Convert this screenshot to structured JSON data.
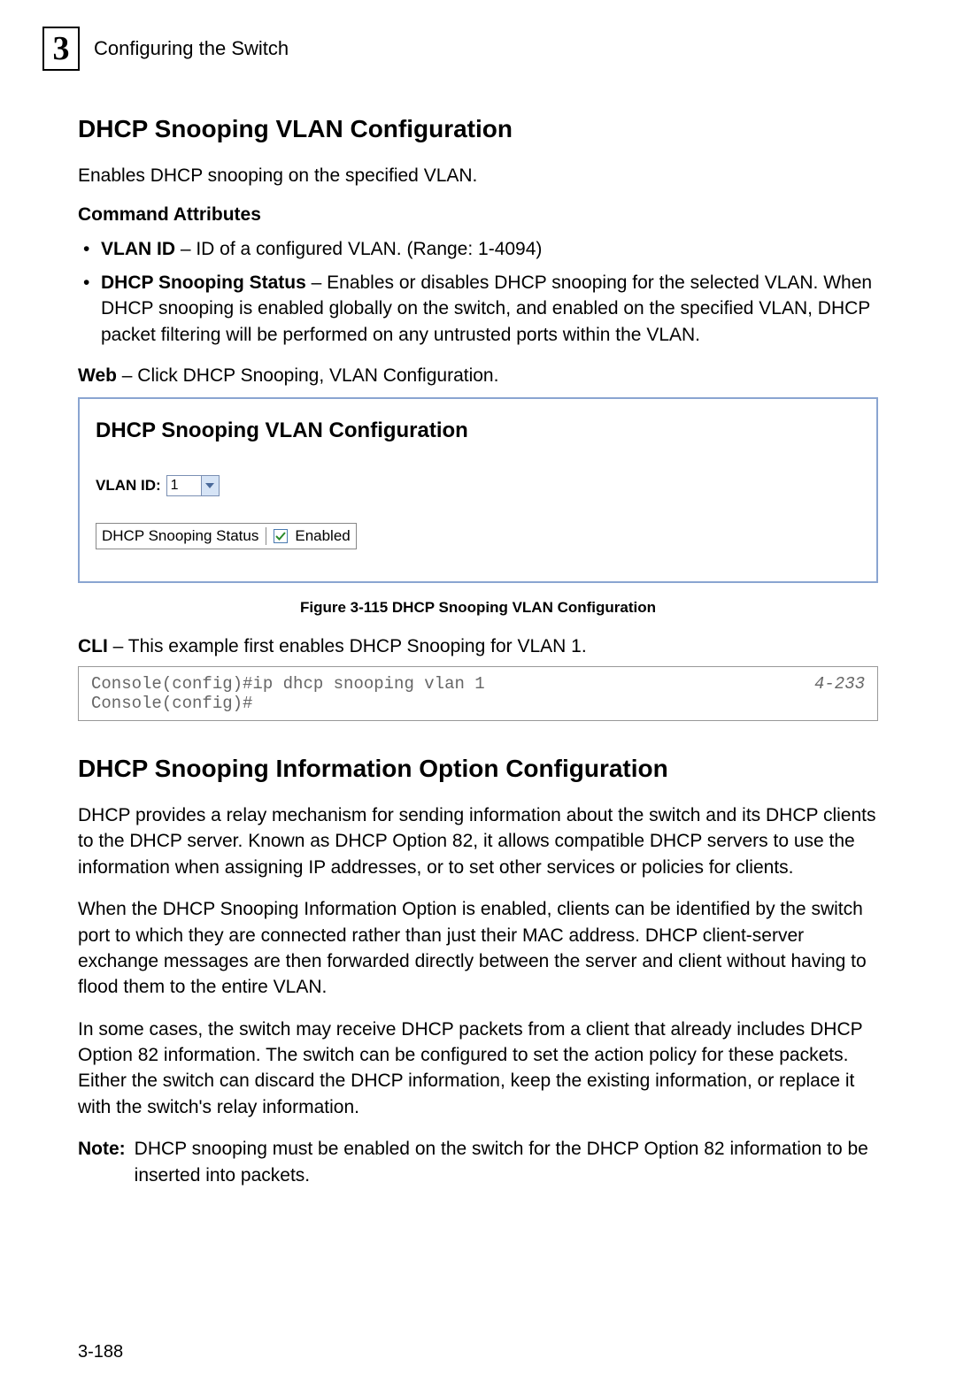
{
  "header": {
    "chapter_number": "3",
    "chapter_title": "Configuring the Switch"
  },
  "section1": {
    "heading": "DHCP Snooping VLAN Configuration",
    "intro": "Enables DHCP snooping on the specified VLAN.",
    "attributes_heading": "Command Attributes",
    "bullets": [
      {
        "label": "VLAN ID",
        "text": " – ID of a configured VLAN. (Range: 1-4094)"
      },
      {
        "label": "DHCP Snooping Status",
        "text": " – Enables or disables DHCP snooping for the selected VLAN. When DHCP snooping is enabled globally on the switch, and enabled on the specified VLAN, DHCP packet filtering will be performed on any untrusted ports within the VLAN."
      }
    ],
    "web_label": "Web",
    "web_text": " – Click DHCP Snooping, VLAN Configuration.",
    "screenshot": {
      "title": "DHCP Snooping VLAN Configuration",
      "vlan_label": "VLAN ID:",
      "vlan_value": "1",
      "status_label": "DHCP Snooping Status",
      "enabled_text": "Enabled"
    },
    "figure_caption": "Figure 3-115  DHCP Snooping VLAN Configuration",
    "cli_label": "CLI",
    "cli_text": " – This example first enables DHCP Snooping for VLAN 1.",
    "code_lines": "Console(config)#ip dhcp snooping vlan 1\nConsole(config)#",
    "code_ref": "4-233"
  },
  "section2": {
    "heading": "DHCP Snooping Information Option Configuration",
    "para1": "DHCP provides a relay mechanism for sending information about the switch and its DHCP clients to the DHCP server. Known as DHCP Option 82, it allows compatible DHCP servers to use the information when assigning IP addresses, or to set other services or policies for clients.",
    "para2": "When the DHCP Snooping Information Option is enabled, clients can be identified by the switch port to which they are connected rather than just their MAC address. DHCP client-server exchange messages are then forwarded directly between the server and client without having to flood them to the entire VLAN.",
    "para3": "In some cases, the switch may receive DHCP packets from a client that already includes DHCP Option 82 information. The switch can be configured to set the action policy for these packets. Either the switch can discard the DHCP information, keep the existing information, or replace it with the switch's relay information.",
    "note_label": "Note:",
    "note_text": "DHCP snooping must be enabled on the switch for the DHCP Option 82 information to be inserted into packets."
  },
  "page_number": "3-188"
}
